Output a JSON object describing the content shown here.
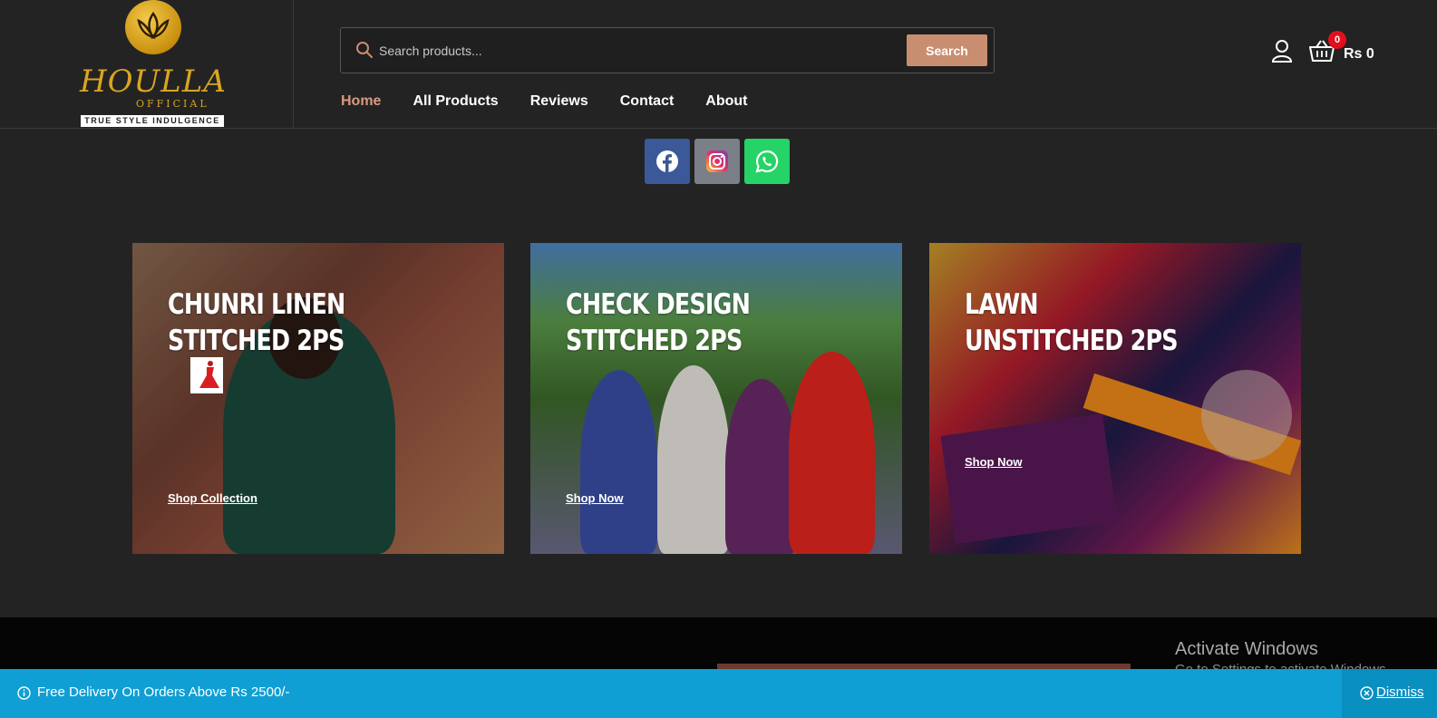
{
  "brand": {
    "name": "HOULLA",
    "subname": "OFFICIAL",
    "tagline": "TRUE STYLE INDULGENCE",
    "colors": {
      "gold": "#d9a521",
      "accent": "#c98d70",
      "background": "#232323"
    }
  },
  "search": {
    "placeholder": "Search products...",
    "button_label": "Search"
  },
  "nav": {
    "items": [
      {
        "label": "Home",
        "active": true
      },
      {
        "label": "All Products",
        "active": false
      },
      {
        "label": "Reviews",
        "active": false
      },
      {
        "label": "Contact",
        "active": false
      },
      {
        "label": "About",
        "active": false
      }
    ]
  },
  "account": {
    "icon": "user-icon"
  },
  "cart": {
    "icon": "basket-icon",
    "count": "0",
    "total": "Rs 0"
  },
  "social": [
    {
      "name": "facebook-icon",
      "color": "#3b5998"
    },
    {
      "name": "instagram-icon",
      "color": "#7a7f88"
    },
    {
      "name": "whatsapp-icon",
      "color": "#25d366"
    }
  ],
  "collections": [
    {
      "title": "CHUNRI LINEN STITCHED 2PS",
      "cta": "Shop Collection"
    },
    {
      "title": "CHECK DESIGN STITCHED 2PS",
      "cta": "Shop Now"
    },
    {
      "title": "LAWN UNSTITCHED 2PS",
      "cta": "Shop Now"
    }
  ],
  "windows": {
    "title": "Activate Windows",
    "subtitle": "Go to Settings to activate Windows."
  },
  "notice": {
    "text": "Free Delivery On Orders Above Rs 2500/-",
    "dismiss_label": "Dismiss",
    "color": "#0f9fd4"
  }
}
